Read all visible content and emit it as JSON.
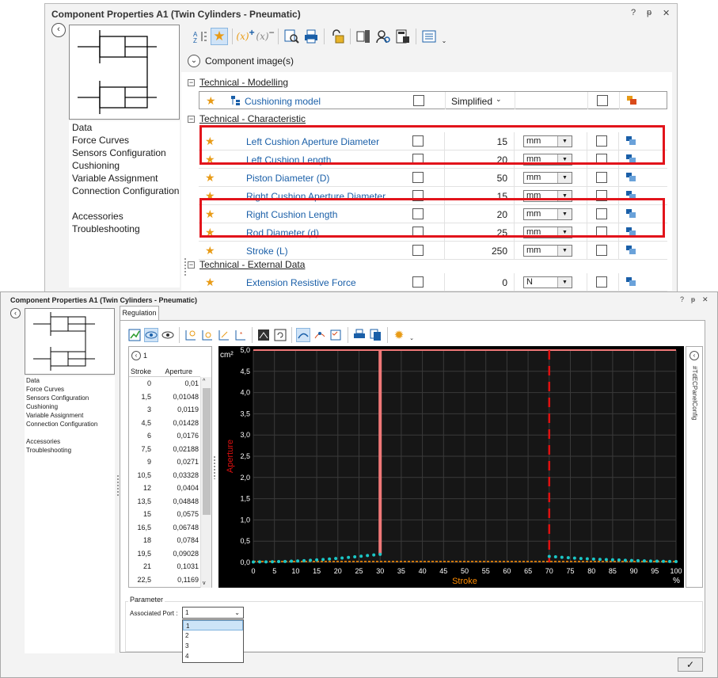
{
  "win1": {
    "title": "Component Properties A1 (Twin Cylinders - Pneumatic)",
    "help": "?",
    "pin": "ᵽ",
    "close": "✕",
    "nav": [
      "Data",
      "Force Curves",
      "Sensors Configuration",
      "Cushioning",
      "Variable Assignment",
      "Connection Configuration"
    ],
    "nav2": [
      "Accessories",
      "Troubleshooting"
    ],
    "component_image_label": "Component image(s)",
    "sections": [
      "Technical - Modelling",
      "Technical - Characteristic",
      "Technical - External Data"
    ],
    "cushioning": {
      "name": "Cushioning model",
      "value": "Simplified"
    },
    "rows": [
      {
        "name": "Left Cushion Aperture Diameter",
        "value": "15",
        "unit": "mm"
      },
      {
        "name": "Left Cushion Length",
        "value": "20",
        "unit": "mm"
      },
      {
        "name": "Piston Diameter (D)",
        "value": "50",
        "unit": "mm"
      },
      {
        "name": "Right Cushion Aperture Diameter",
        "value": "15",
        "unit": "mm"
      },
      {
        "name": "Right Cushion Length",
        "value": "20",
        "unit": "mm"
      },
      {
        "name": "Rod Diameter (d)",
        "value": "25",
        "unit": "mm"
      },
      {
        "name": "Stroke (L)",
        "value": "250",
        "unit": "mm"
      }
    ],
    "external": {
      "name": "Extension Resistive Force",
      "value": "0",
      "unit": "N"
    }
  },
  "win2": {
    "title": "Component Properties A1 (Twin Cylinders - Pneumatic)",
    "help": "?",
    "pin": "ᵽ",
    "close": "✕",
    "tab": "Regulation",
    "nav": [
      "Data",
      "Force Curves",
      "Sensors Configuration",
      "Cushioning",
      "Variable Assignment",
      "Connection Configuration"
    ],
    "nav2": [
      "Accessories",
      "Troubleshooting"
    ],
    "table_selector": "1",
    "table_headers": [
      "Stroke",
      "Aperture"
    ],
    "table_rows": [
      [
        "0",
        "0,01"
      ],
      [
        "1,5",
        "0,01048"
      ],
      [
        "3",
        "0,0119"
      ],
      [
        "4,5",
        "0,01428"
      ],
      [
        "6",
        "0,0176"
      ],
      [
        "7,5",
        "0,02188"
      ],
      [
        "9",
        "0,0271"
      ],
      [
        "10,5",
        "0,03328"
      ],
      [
        "12",
        "0,0404"
      ],
      [
        "13,5",
        "0,04848"
      ],
      [
        "15",
        "0,0575"
      ],
      [
        "16,5",
        "0,06748"
      ],
      [
        "18",
        "0,0784"
      ],
      [
        "19,5",
        "0,09028"
      ],
      [
        "21",
        "0,1031"
      ],
      [
        "22,5",
        "0,1169"
      ]
    ],
    "side_panel_label": "#TdECPanelConfig",
    "parameter_title": "Parameter",
    "associated_port_label": "Associated Port :",
    "associated_port_value": "1",
    "port_options": [
      "1",
      "2",
      "3",
      "4"
    ],
    "ok": "✓"
  },
  "chart_data": {
    "type": "scatter",
    "xlabel": "Stroke",
    "ylabel": "Aperture",
    "xunit": "%",
    "yunit": "cm²",
    "xlim": [
      0,
      100
    ],
    "ylim": [
      0,
      5
    ],
    "xticks": [
      "0",
      "5",
      "10",
      "15",
      "20",
      "25",
      "30",
      "35",
      "40",
      "45",
      "50",
      "55",
      "60",
      "65",
      "70",
      "75",
      "80",
      "85",
      "90",
      "95",
      "100"
    ],
    "yticks": [
      "0,0",
      "0,5",
      "1,0",
      "1,5",
      "2,0",
      "2,5",
      "3,0",
      "3,5",
      "4,0",
      "4,5",
      "5,0"
    ],
    "grid": true,
    "left_points": {
      "x": [
        0,
        1.5,
        3,
        4.5,
        6,
        7.5,
        9,
        10.5,
        12,
        13.5,
        15,
        16.5,
        18,
        19.5,
        21,
        22.5,
        24,
        25.5,
        27,
        28.5,
        30
      ],
      "y": [
        0.01,
        0.0105,
        0.0119,
        0.0143,
        0.0176,
        0.0219,
        0.0271,
        0.0333,
        0.0404,
        0.0485,
        0.0575,
        0.0675,
        0.0784,
        0.0903,
        0.1031,
        0.1169,
        0.13,
        0.145,
        0.16,
        0.175,
        0.19
      ]
    },
    "right_points": {
      "x": [
        70,
        71.5,
        73,
        74.5,
        76,
        77.5,
        79,
        80.5,
        82,
        83.5,
        85,
        86.5,
        88,
        89.5,
        91,
        92.5,
        94,
        95.5,
        97,
        98.5,
        100
      ],
      "y": [
        0.14,
        0.13,
        0.12,
        0.11,
        0.1,
        0.09,
        0.085,
        0.078,
        0.07,
        0.065,
        0.06,
        0.055,
        0.05,
        0.045,
        0.04,
        0.035,
        0.03,
        0.027,
        0.024,
        0.02,
        0.018
      ]
    },
    "left_step": {
      "x": 30,
      "y_low": 0.19,
      "y_high": 5.0
    },
    "right_marker_x": 70,
    "baseline_y": 0.02,
    "colors": {
      "points": "#1bc6c6",
      "step": "#f07878",
      "marker": "#e01010",
      "top_line": "#f07878",
      "baseline": "#ff8c00",
      "xlabel": "#ff8c00",
      "ylabel": "#e01010"
    }
  }
}
